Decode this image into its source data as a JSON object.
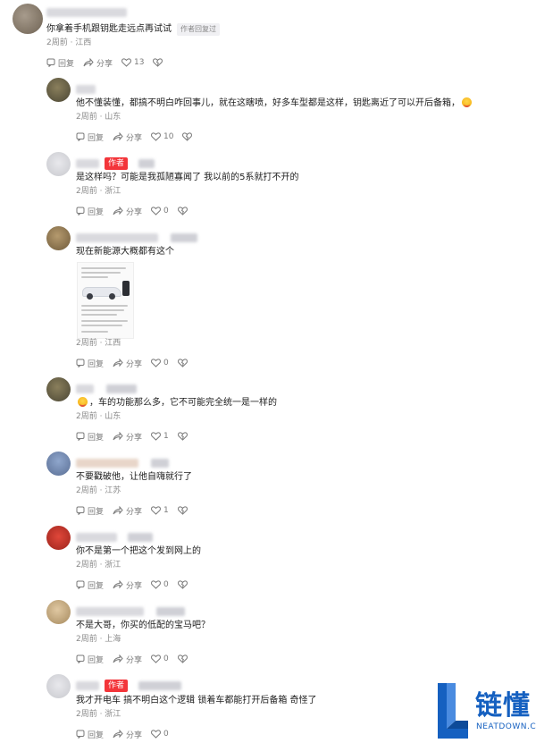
{
  "labels": {
    "reply": "回复",
    "share": "分享",
    "author_badge": "作者",
    "author_replied": "作者回复过"
  },
  "comments": [
    {
      "text": "你拿着手机跟钥匙走远点再试试",
      "meta": "2周前 · 江西",
      "likes": "13",
      "author_replied": true
    },
    {
      "text": "他不懂装懂，都搞不明白咋回事儿，就在这瞎喷，好多车型都是这样，钥匙离近了可以开后备箱，",
      "meta": "2周前 · 山东",
      "likes": "10"
    },
    {
      "text": "是这样吗？可能是我孤陋寡闻了 我以前的5系就打不开的",
      "meta": "2周前 · 浙江",
      "likes": "0",
      "is_author": true
    },
    {
      "text": "现在新能源大概都有这个",
      "meta": "2周前 · 江西",
      "likes": "0",
      "has_image": true
    },
    {
      "text": "，车的功能那么多，它不可能完全统一是一样的",
      "meta": "2周前 · 山东",
      "likes": "1"
    },
    {
      "text": "不要戳破他，让他自嗨就行了",
      "meta": "2周前 · 江苏",
      "likes": "1"
    },
    {
      "text": "你不是第一个把这个发到网上的",
      "meta": "2周前 · 浙江",
      "likes": "0"
    },
    {
      "text": "不是大哥，你买的低配的宝马吧？",
      "meta": "2周前 · 上海",
      "likes": "0"
    },
    {
      "text": "我才开电车 搞不明白这个逻辑 锁着车都能打开后备箱 奇怪了",
      "meta": "2周前 · 浙江",
      "likes": "0",
      "is_author": true
    }
  ],
  "watermark": {
    "title": "链懂",
    "subtitle": "NEATDOWN.COM"
  },
  "colors": {
    "author_badge": "#f3353a",
    "watermark": "#1560c0",
    "meta": "#8a8a8a"
  }
}
